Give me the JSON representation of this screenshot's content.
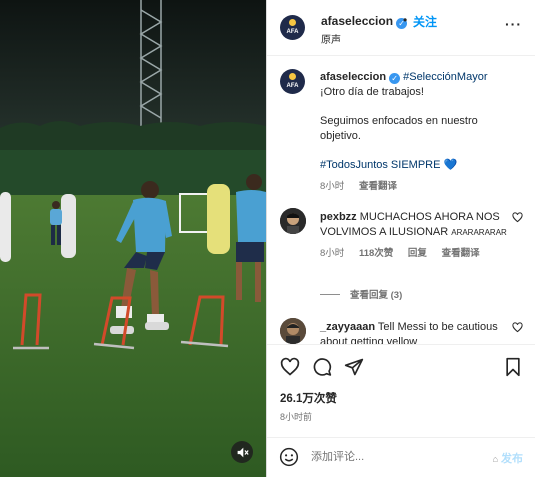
{
  "header": {
    "username": "afaseleccion",
    "dot": "•",
    "follow_label": "关注",
    "audio_label": "原声",
    "avatar_text": "AFA",
    "more_label": "···"
  },
  "caption": {
    "username": "afaseleccion",
    "hashtag": "#SelecciónMayor",
    "line1": "¡Otro día de trabajos!",
    "line2": "Seguimos enfocados en nuestro objetivo.",
    "line3": "#TodosJuntos SIEMPRE",
    "heart": "💙",
    "time": "8小时",
    "translate": "查看翻译"
  },
  "comments": [
    {
      "username": "pexbzz",
      "text": "MUCHACHOS AHORA NOS VOLVIMOS A ILUSIONAR",
      "tail": "ARARARARAR",
      "time": "8小时",
      "likes": "118次赞",
      "reply": "回复",
      "translate": "查看翻译",
      "view_replies": "查看回复 (3)"
    },
    {
      "username": "_zayyaaan",
      "text": "Tell Messi to be cautious about getting yellow"
    }
  ],
  "actions": {
    "likes_count": "26.1万次赞",
    "time_ago": "8小时前"
  },
  "add_comment": {
    "placeholder": "添加评论...",
    "post_label": "发布",
    "post_icon": "⌂"
  },
  "colors": {
    "accent": "#0095f6",
    "verified": "#3897f0",
    "hashtag": "#00376b"
  }
}
